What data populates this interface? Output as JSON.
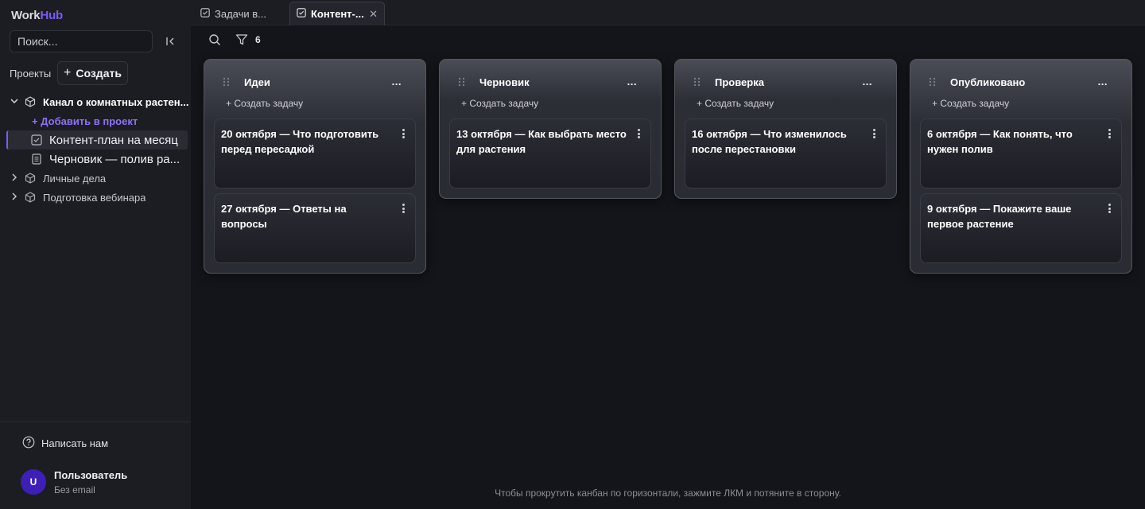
{
  "app": {
    "logo_part1": "Work",
    "logo_part2": "Hub",
    "brand_color": "#7c5cf0"
  },
  "sidebar": {
    "search_placeholder": "Поиск...",
    "projects_label": "Проекты",
    "create_label": "Создать",
    "tree": {
      "open_project": "Канал о комнатных растен...",
      "add_to_project": "+ Добавить в проект",
      "items": [
        {
          "label": "Контент-план на месяц",
          "icon": "task-board-icon",
          "active": true
        },
        {
          "label": "Черновик — полив ра...",
          "icon": "document-icon",
          "active": false
        }
      ],
      "closed_projects": [
        "Личные дела",
        "Подготовка вебинара"
      ]
    },
    "contact_label": "Написать нам",
    "user": {
      "initial": "U",
      "name": "Пользователь",
      "email": "Без email"
    }
  },
  "tabs": [
    {
      "label": "Задачи в...",
      "active": false
    },
    {
      "label": "Контент-...",
      "active": true
    }
  ],
  "toolbar": {
    "filter_count": "6"
  },
  "board": {
    "create_task_label": "+ Создать задачу",
    "more_label": "...",
    "columns": [
      {
        "title": "Идеи",
        "cards": [
          "20 октября — Что подготовить перед пересадкой",
          "27 октября — Ответы на вопросы"
        ]
      },
      {
        "title": "Черновик",
        "cards": [
          "13 октября — Как выбрать место для растения"
        ]
      },
      {
        "title": "Проверка",
        "cards": [
          "16 октября — Что изменилось после перестановки"
        ]
      },
      {
        "title": "Опубликовано",
        "cards": [
          "6 октября — Как понять, что нужен полив",
          "9 октября — Покажите ваше первое растение"
        ]
      }
    ]
  },
  "hint": "Чтобы прокрутить канбан по горизонтали, зажмите ЛКМ и потяните в сторону."
}
